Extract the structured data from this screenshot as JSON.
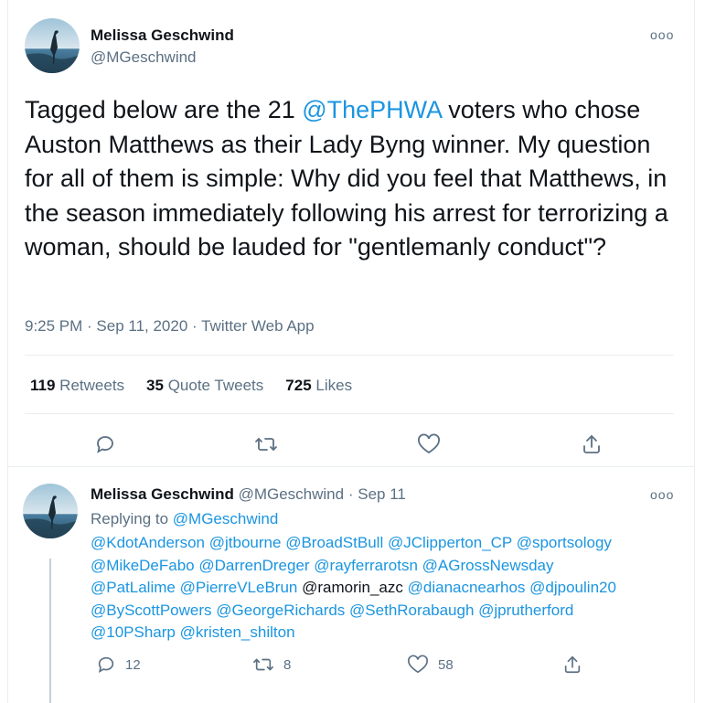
{
  "main_tweet": {
    "author_name": "Melissa Geschwind",
    "author_handle": "@MGeschwind",
    "text_part1": "Tagged below are the 21 ",
    "mention": "@ThePHWA",
    "text_part2": " voters who chose Auston Matthews as their Lady Byng winner. My question for all of them is simple: Why did you feel that Matthews, in the season immediately following his arrest for terrorizing a woman, should be lauded for \"gentlemanly conduct\"?",
    "timestamp": "9:25 PM · Sep 11, 2020 · Twitter Web App",
    "stats": {
      "retweets_count": "119",
      "retweets_label": "Retweets",
      "quotes_count": "35",
      "quotes_label": "Quote Tweets",
      "likes_count": "725",
      "likes_label": "Likes"
    },
    "more_label": "ooo"
  },
  "reply_tweet": {
    "author_name": "Melissa Geschwind",
    "author_handle": "@MGeschwind",
    "sep": "·",
    "date": "Sep 11",
    "replying_label": "Replying to ",
    "replying_handle": "@MGeschwind",
    "mentions_line1": [
      "@KdotAnderson",
      "@jtbourne",
      "@BroadStBull",
      "@JClipperton_CP",
      "@sportsology"
    ],
    "mentions_line2": [
      "@MikeDeFabo",
      "@DarrenDreger",
      "@rayferrarotsn",
      "@AGrossNewsday"
    ],
    "mentions_line3a": [
      "@PatLalime",
      "@PierreVLeBrun"
    ],
    "plain_mention": "@ramorin_azc",
    "mentions_line3b": [
      "@dianacnearhos",
      "@djpoulin20"
    ],
    "mentions_line4": [
      "@ByScottPowers",
      "@GeorgeRichards",
      "@SethRorabaugh",
      "@jprutherford"
    ],
    "mentions_line5": [
      "@10PSharp",
      "@kristen_shilton"
    ],
    "reply_count": "12",
    "retweet_count": "8",
    "like_count": "58",
    "more_label": "ooo"
  },
  "colors": {
    "link": "#1b95e0",
    "muted": "#5b7083",
    "text": "#0f1419"
  }
}
